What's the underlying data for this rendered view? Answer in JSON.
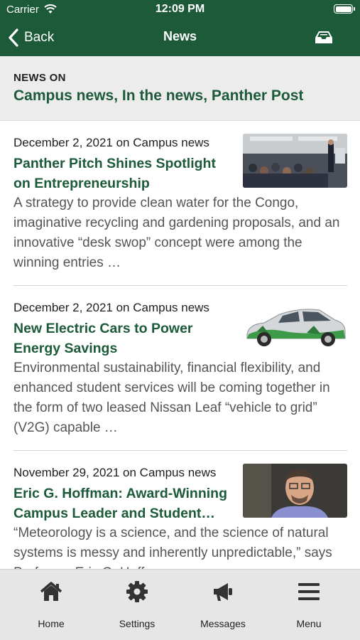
{
  "status_bar": {
    "carrier": "Carrier",
    "time": "12:09 PM"
  },
  "nav": {
    "back_label": "Back",
    "title": "News",
    "inbox_icon": "inbox-icon"
  },
  "header": {
    "news_on_label": "NEWS ON",
    "feeds": "Campus news, In the news, Panther Post"
  },
  "articles": [
    {
      "meta": "December 2, 2021 on Campus news",
      "title": "Panther Pitch Shines Spotlight on Entrepreneurship",
      "summary": "A strategy to provide clean water for the Congo, imaginative recycling and gardening proposals, and an innovative “desk swop” concept were among the winning entries …",
      "thumbnail": "event-photo"
    },
    {
      "meta": "December 2, 2021 on Campus news",
      "title": "New Electric Cars to Power Energy Savings",
      "summary": "Environmental sustainability, financial flexibility, and enhanced student services will be coming together in the form of two leased Nissan Leaf “vehicle to grid” (V2G) capable …",
      "thumbnail": "electric-car-photo"
    },
    {
      "meta": "November 29, 2021 on Campus news",
      "title": "Eric G. Hoffman: Award-Winning Campus Leader and Student…",
      "summary": "“Meteorology is a science, and the science of natural systems is messy and inherently unpredictable,” says Professor Eric G. Hoffman …",
      "thumbnail": "portrait-photo"
    }
  ],
  "tabs": [
    {
      "label": "Home",
      "icon": "home-icon"
    },
    {
      "label": "Settings",
      "icon": "gear-icon"
    },
    {
      "label": "Messages",
      "icon": "megaphone-icon"
    },
    {
      "label": "Menu",
      "icon": "menu-icon"
    }
  ],
  "colors": {
    "brand": "#1c5a3a",
    "header_bg": "#ececed",
    "tabbar_bg": "#e6e6e6"
  }
}
